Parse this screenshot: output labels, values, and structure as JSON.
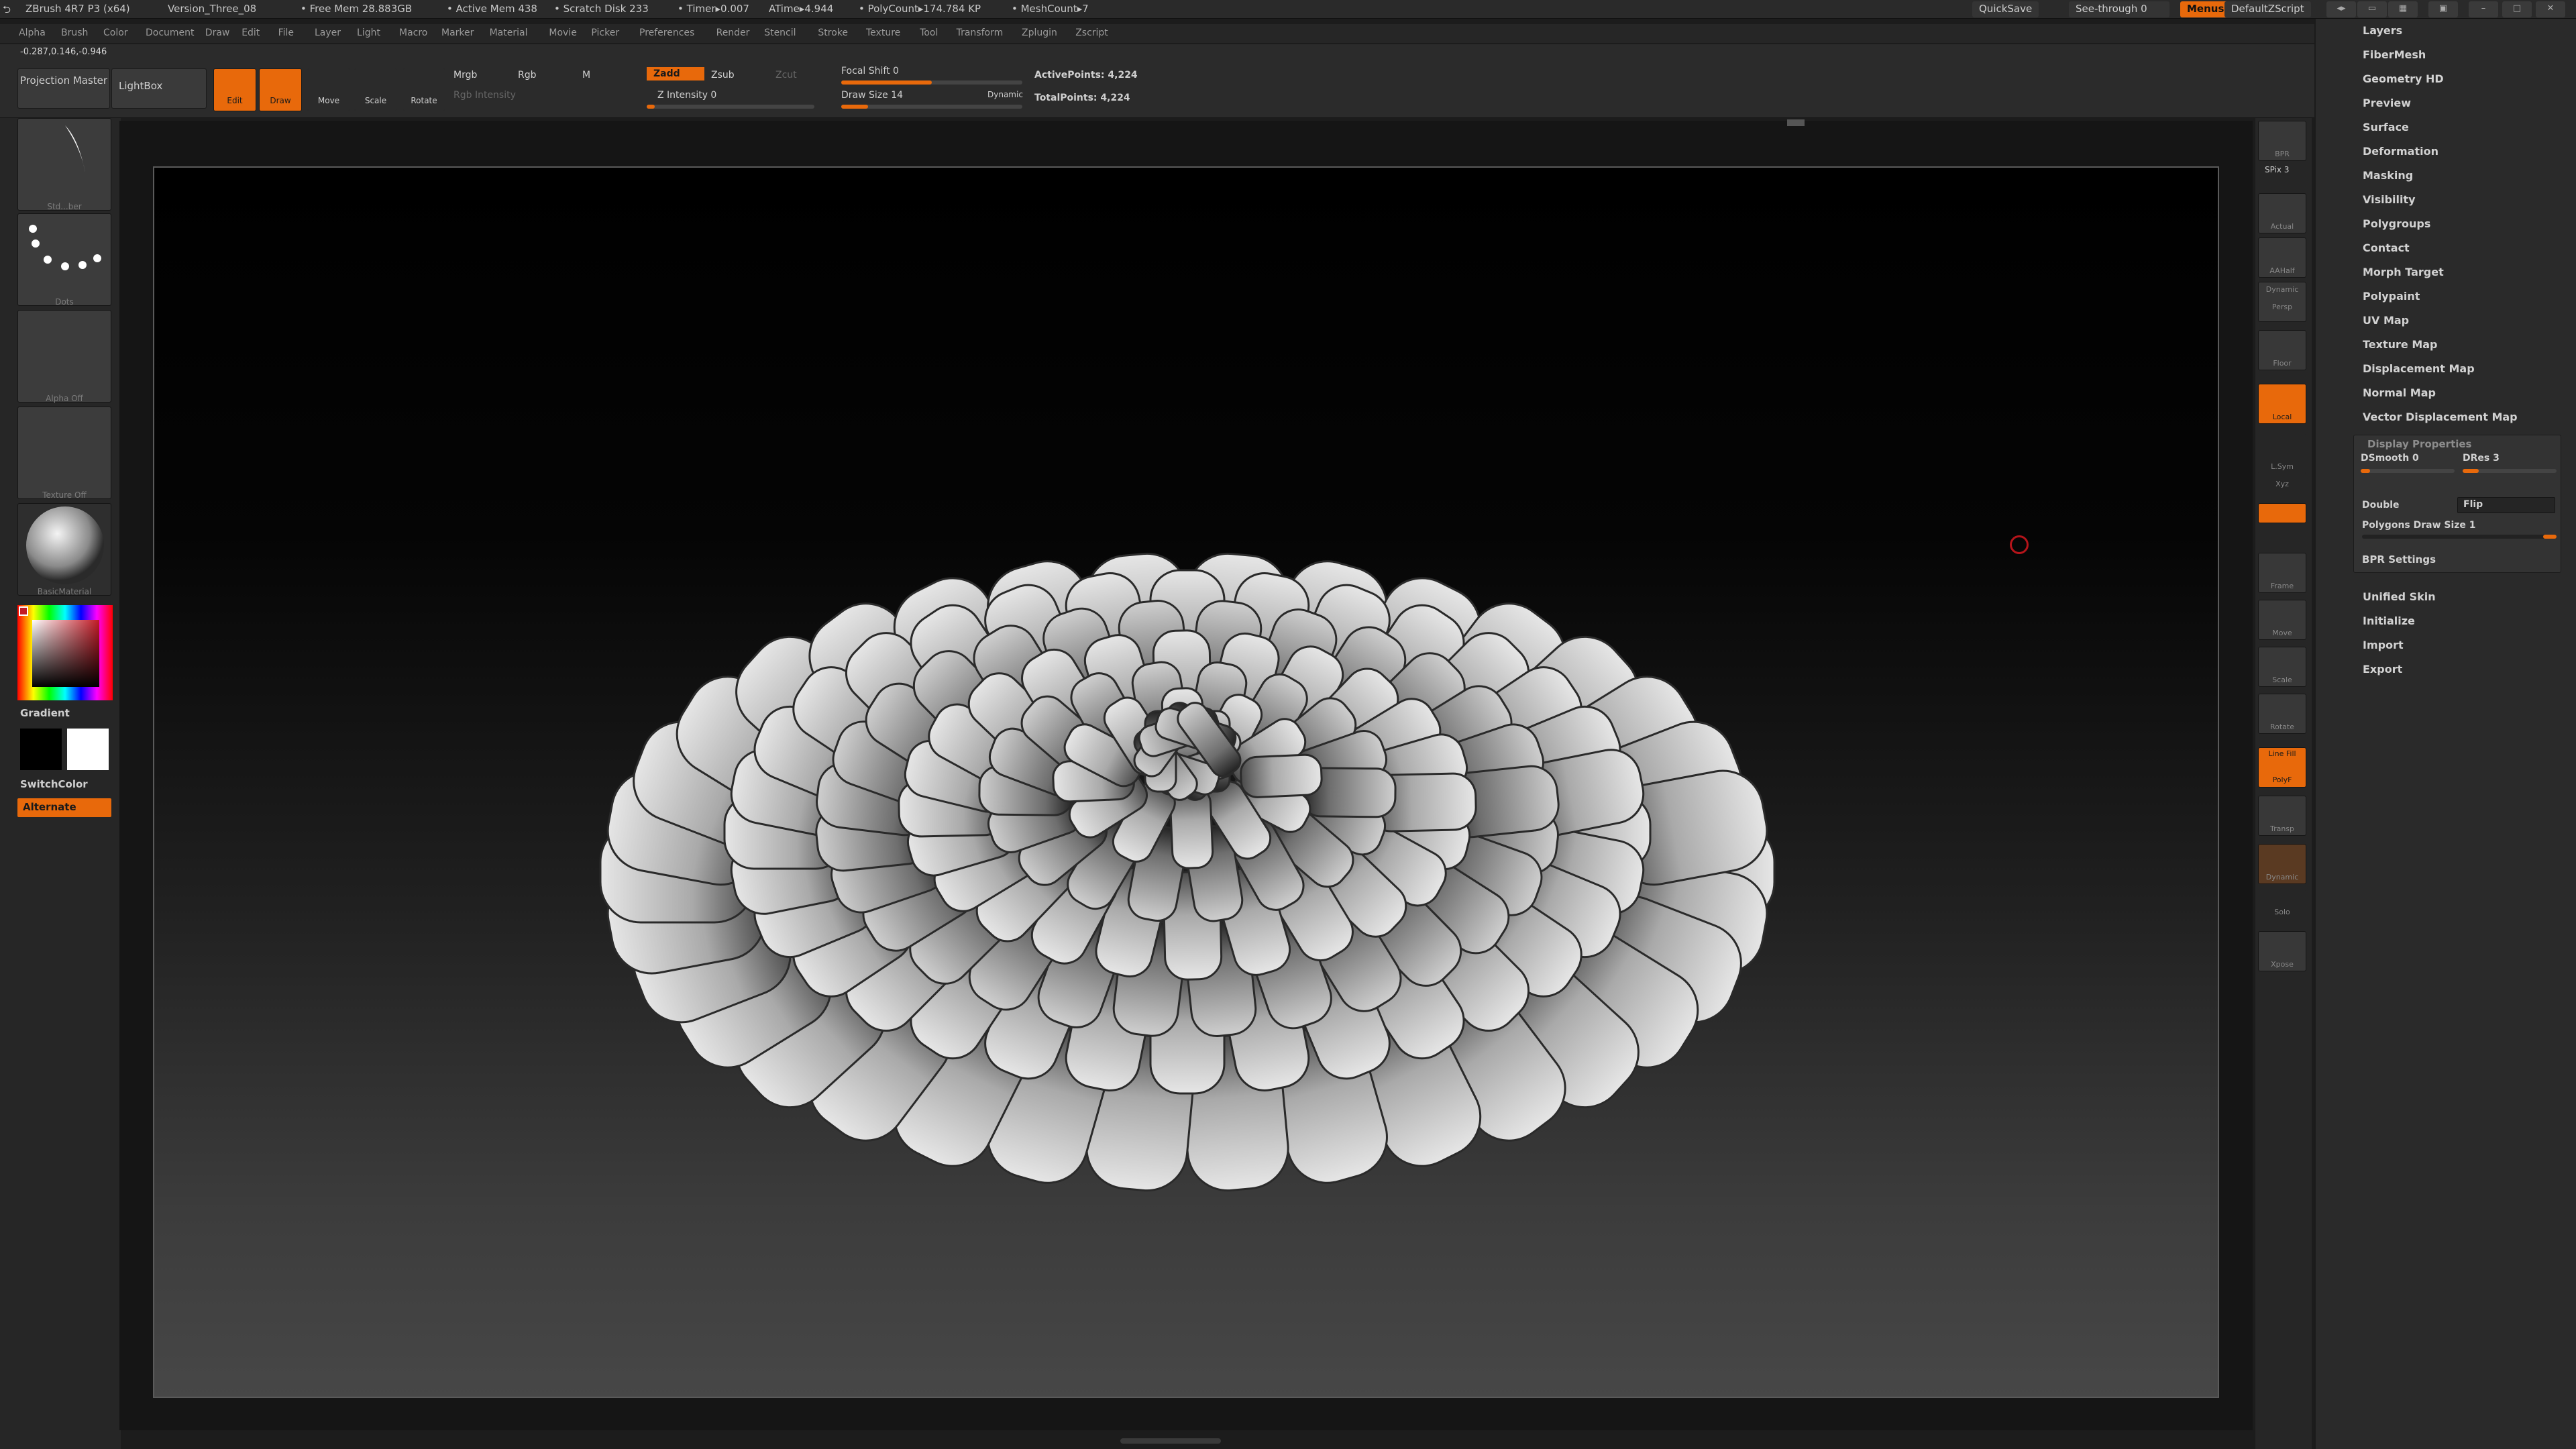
{
  "titlebar": {
    "app": "ZBrush 4R7 P3 (x64)",
    "doc": "Version_Three_08",
    "free_mem": "• Free Mem 28.883GB",
    "active_mem": "• Active Mem 438",
    "scratch": "• Scratch Disk 233",
    "timer": "• Timer▸0.007",
    "atime": "ATime▸4.944",
    "polycount": "• PolyCount▸174.784 KP",
    "meshcount": "• MeshCount▸7",
    "quicksave": "QuickSave",
    "seethrough": "See-through 0",
    "menus": "Menus",
    "script": "DefaultZScript"
  },
  "menubar": [
    "Alpha",
    "Brush",
    "Color",
    "Document",
    "Draw",
    "Edit",
    "File",
    "Layer",
    "Light",
    "Macro",
    "Marker",
    "Material",
    "Movie",
    "Picker",
    "Preferences",
    "Render",
    "Stencil",
    "Stroke",
    "Texture",
    "Tool",
    "Transform",
    "Zplugin",
    "Zscript"
  ],
  "toolbar": {
    "coords": "-0.287,0.146,-0.946",
    "projection_master": "Projection Master",
    "lightbox": "LightBox",
    "edit": "Edit",
    "draw": "Draw",
    "move": "Move",
    "scale": "Scale",
    "rotate": "Rotate",
    "mrgb": "Mrgb",
    "rgb": "Rgb",
    "m": "M",
    "rgb_intensity": "Rgb Intensity",
    "zadd": "Zadd",
    "zsub": "Zsub",
    "zcut": "Zcut",
    "z_intensity": "Z Intensity 0",
    "focal_shift": "Focal Shift 0",
    "draw_size": "Draw Size 14",
    "dynamic": "Dynamic",
    "active_points": "ActivePoints: 4,224",
    "total_points": "TotalPoints: 4,224"
  },
  "leftshelf": {
    "brush": "Std...ber",
    "stroke": "Dots",
    "alpha": "Alpha Off",
    "texture": "Texture Off",
    "material": "BasicMaterial",
    "gradient": "Gradient",
    "switchcolor": "SwitchColor",
    "alternate": "Alternate"
  },
  "rightshelf": {
    "bpr": "BPR",
    "spix": "SPix 3",
    "actual": "Actual",
    "aahalf": "AAHalf",
    "dynamic": "Dynamic",
    "persp": "Persp",
    "floor": "Floor",
    "local": "Local",
    "lsym": "L.Sym",
    "xyz": "Xyz",
    "frame": "Frame",
    "move": "Move",
    "scale": "Scale",
    "rotate": "Rotate",
    "linefill": "Line Fill",
    "polyf": "PolyF",
    "transp": "Transp",
    "ghost": "Dynamic",
    "solo": "Solo",
    "xpose": "Xpose"
  },
  "toolpanel": {
    "items_top": [
      "Layers",
      "FiberMesh",
      "Geometry HD",
      "Preview",
      "Surface",
      "Deformation",
      "Masking",
      "Visibility",
      "Polygroups",
      "Contact",
      "Morph Target",
      "Polypaint",
      "UV Map",
      "Texture Map",
      "Displacement Map",
      "Normal Map",
      "Vector Displacement Map"
    ],
    "display_properties": "Display Properties",
    "dsmooth": "DSmooth 0",
    "dres": "DRes 3",
    "double": "Double",
    "flip": "Flip",
    "polygons_draw_size": "Polygons Draw Size 1",
    "bpr_settings": "BPR Settings",
    "items_bottom": [
      "Unified Skin",
      "Initialize",
      "Import",
      "Export"
    ]
  },
  "colors": {
    "accent": "#e8690b",
    "panel": "#2a2a2a"
  }
}
